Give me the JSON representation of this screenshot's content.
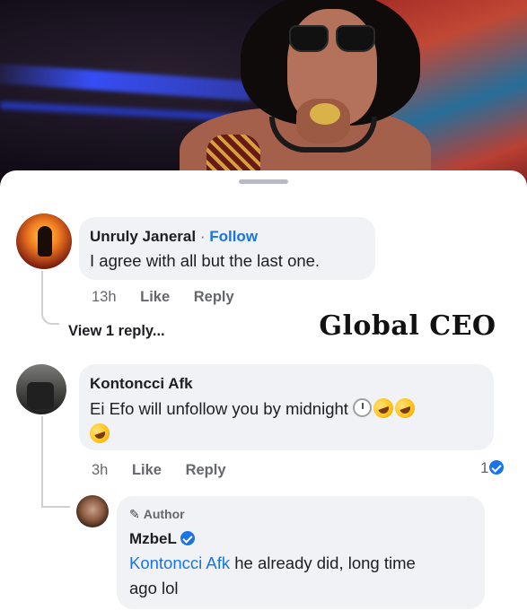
{
  "watermark": "Global CEO",
  "comments": [
    {
      "name": "Unruly Janeral",
      "separator": " · ",
      "follow_label": "Follow",
      "text": "I agree with all but the last one.",
      "time": "13h",
      "like_label": "Like",
      "reply_label": "Reply",
      "view_replies": "View 1 reply..."
    },
    {
      "name": "Kontoncci Afk",
      "text": "Ei Efo will unfollow you by midnight",
      "time": "3h",
      "like_label": "Like",
      "reply_label": "Reply",
      "reaction_count": "1",
      "emojis": [
        "clock-icon",
        "rolling-laughing-emoji",
        "rolling-laughing-emoji",
        "rolling-laughing-emoji"
      ]
    }
  ],
  "reply": {
    "badge": "Author",
    "name": "MzbeL",
    "mention": "Kontoncci Afk",
    "text_line1": " he already did, long time",
    "text_line2": "ago lol"
  },
  "colors": {
    "link": "#1b74e4",
    "bubble": "#f0f2f5",
    "meta": "#65676b"
  }
}
